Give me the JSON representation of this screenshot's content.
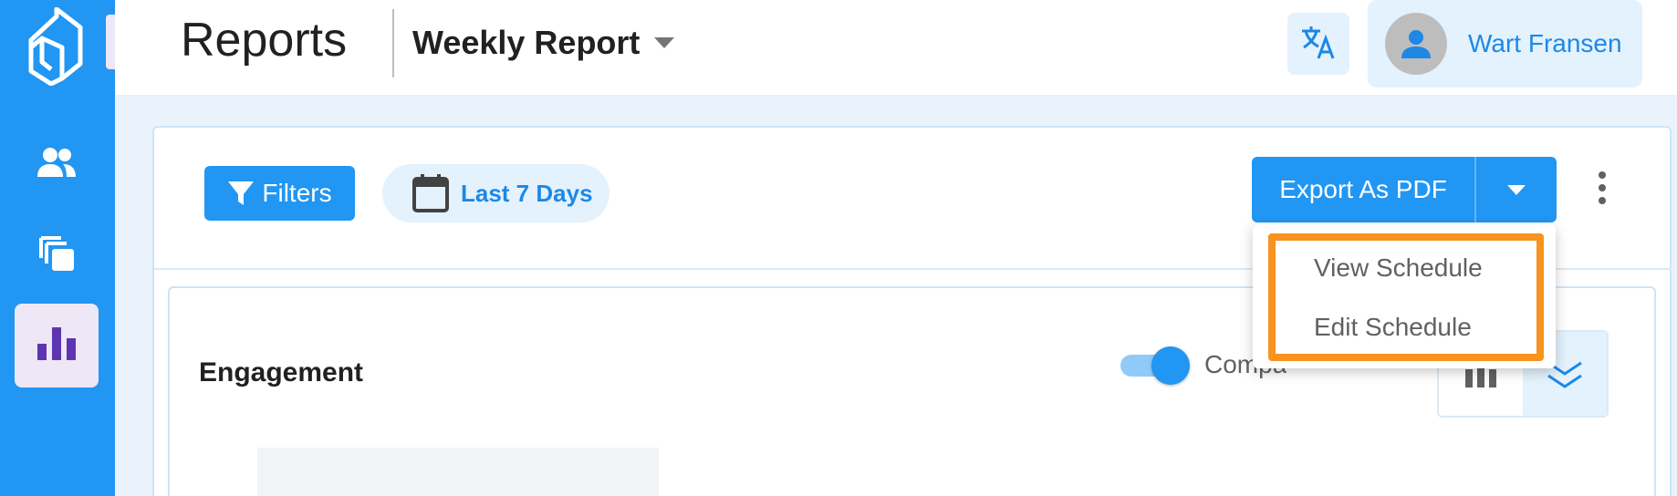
{
  "header": {
    "page_title": "Reports",
    "report_selector": "Weekly Report"
  },
  "user": {
    "name": "Wart Fransen"
  },
  "sidebar": {
    "items": [
      {
        "name": "users-icon",
        "active": false
      },
      {
        "name": "pages-icon",
        "active": false
      },
      {
        "name": "reports-icon",
        "active": true
      }
    ]
  },
  "toolbar": {
    "filters_label": "Filters",
    "date_range_label": "Last 7 Days",
    "export_label": "Export As PDF"
  },
  "export_menu": {
    "items": [
      "View Schedule",
      "Edit Schedule"
    ]
  },
  "section": {
    "title": "Engagement",
    "compare_label": "Compa"
  },
  "colors": {
    "primary": "#2196f3",
    "sidebar_active_bg": "#ede7f6",
    "highlight": "#f7931e"
  }
}
